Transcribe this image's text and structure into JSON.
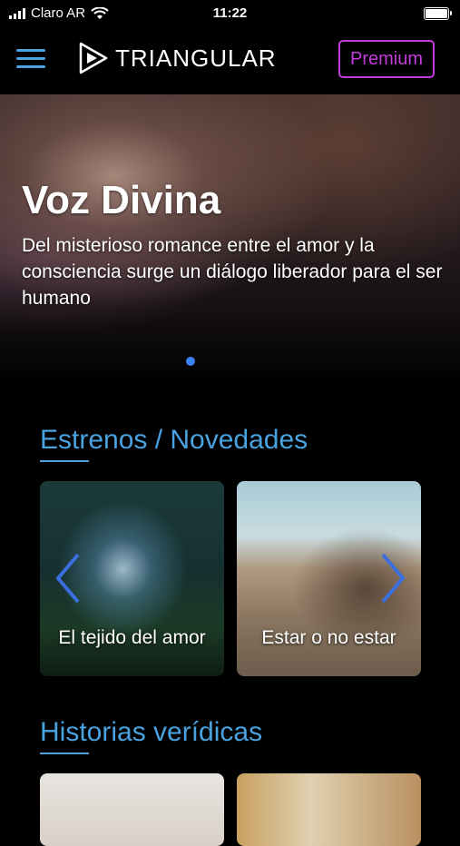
{
  "status_bar": {
    "carrier": "Claro AR",
    "time": "11:22"
  },
  "header": {
    "logo_text": "TRIANGULAR",
    "premium_label": "Premium"
  },
  "hero": {
    "title": "Voz Divina",
    "subtitle": "Del misterioso romance entre el amor y la consciencia surge un diálogo liberador para el ser humano"
  },
  "sections": [
    {
      "title": "Estrenos / Novedades",
      "cards": [
        {
          "label": "El tejido del amor"
        },
        {
          "label": "Estar o no estar"
        }
      ]
    },
    {
      "title": "Historias verídicas"
    }
  ],
  "colors": {
    "accent": "#4aa3e0",
    "premium": "#c23cdb",
    "dot": "#3b82f6"
  },
  "icons": [
    "signal-icon",
    "wifi-icon",
    "battery-icon",
    "hamburger-icon",
    "logo-play-icon",
    "chevron-left-icon",
    "chevron-right-icon"
  ]
}
